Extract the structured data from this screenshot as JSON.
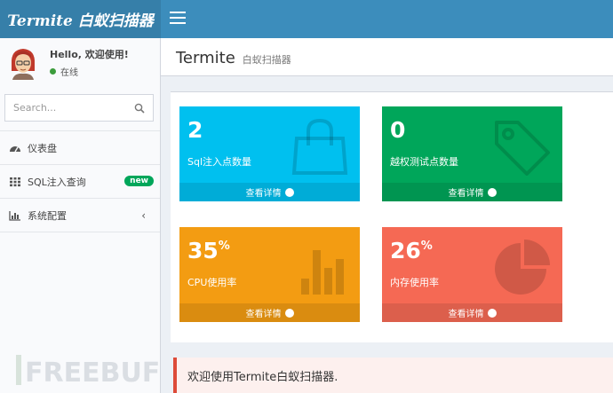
{
  "header": {
    "logo": "Termite 白蚁扫描器"
  },
  "user": {
    "greeting": "Hello, 欢迎使用!",
    "status": "在线"
  },
  "search": {
    "placeholder": "Search..."
  },
  "menu": [
    {
      "label": "仪表盘",
      "icon": "dashboard-icon"
    },
    {
      "label": "SQL注入查询",
      "icon": "table-icon",
      "badge": "new"
    },
    {
      "label": "系统配置",
      "icon": "bar-chart-icon"
    }
  ],
  "page": {
    "title": "Termite",
    "subtitle": "白蚁扫描器"
  },
  "boxes": [
    {
      "value": "2",
      "label": "Sql注入点数量",
      "footer": "查看详情",
      "icon": "shopping-bag-icon",
      "color": "#00c0ef"
    },
    {
      "value": "0",
      "label": "越权测试点数量",
      "footer": "查看详情",
      "icon": "tag-icon",
      "color": "#00a65a"
    },
    {
      "value": "35",
      "unit": "%",
      "label": "CPU使用率",
      "footer": "查看详情",
      "icon": "bar-chart-icon",
      "color": "#f39c12"
    },
    {
      "value": "26",
      "unit": "%",
      "label": "内存使用率",
      "footer": "查看详情",
      "icon": "pie-chart-icon",
      "color": "#f56954"
    }
  ],
  "callout": {
    "text": "欢迎使用Termite白蚁扫描器."
  },
  "watermark": {
    "text": "FREEBUF"
  }
}
